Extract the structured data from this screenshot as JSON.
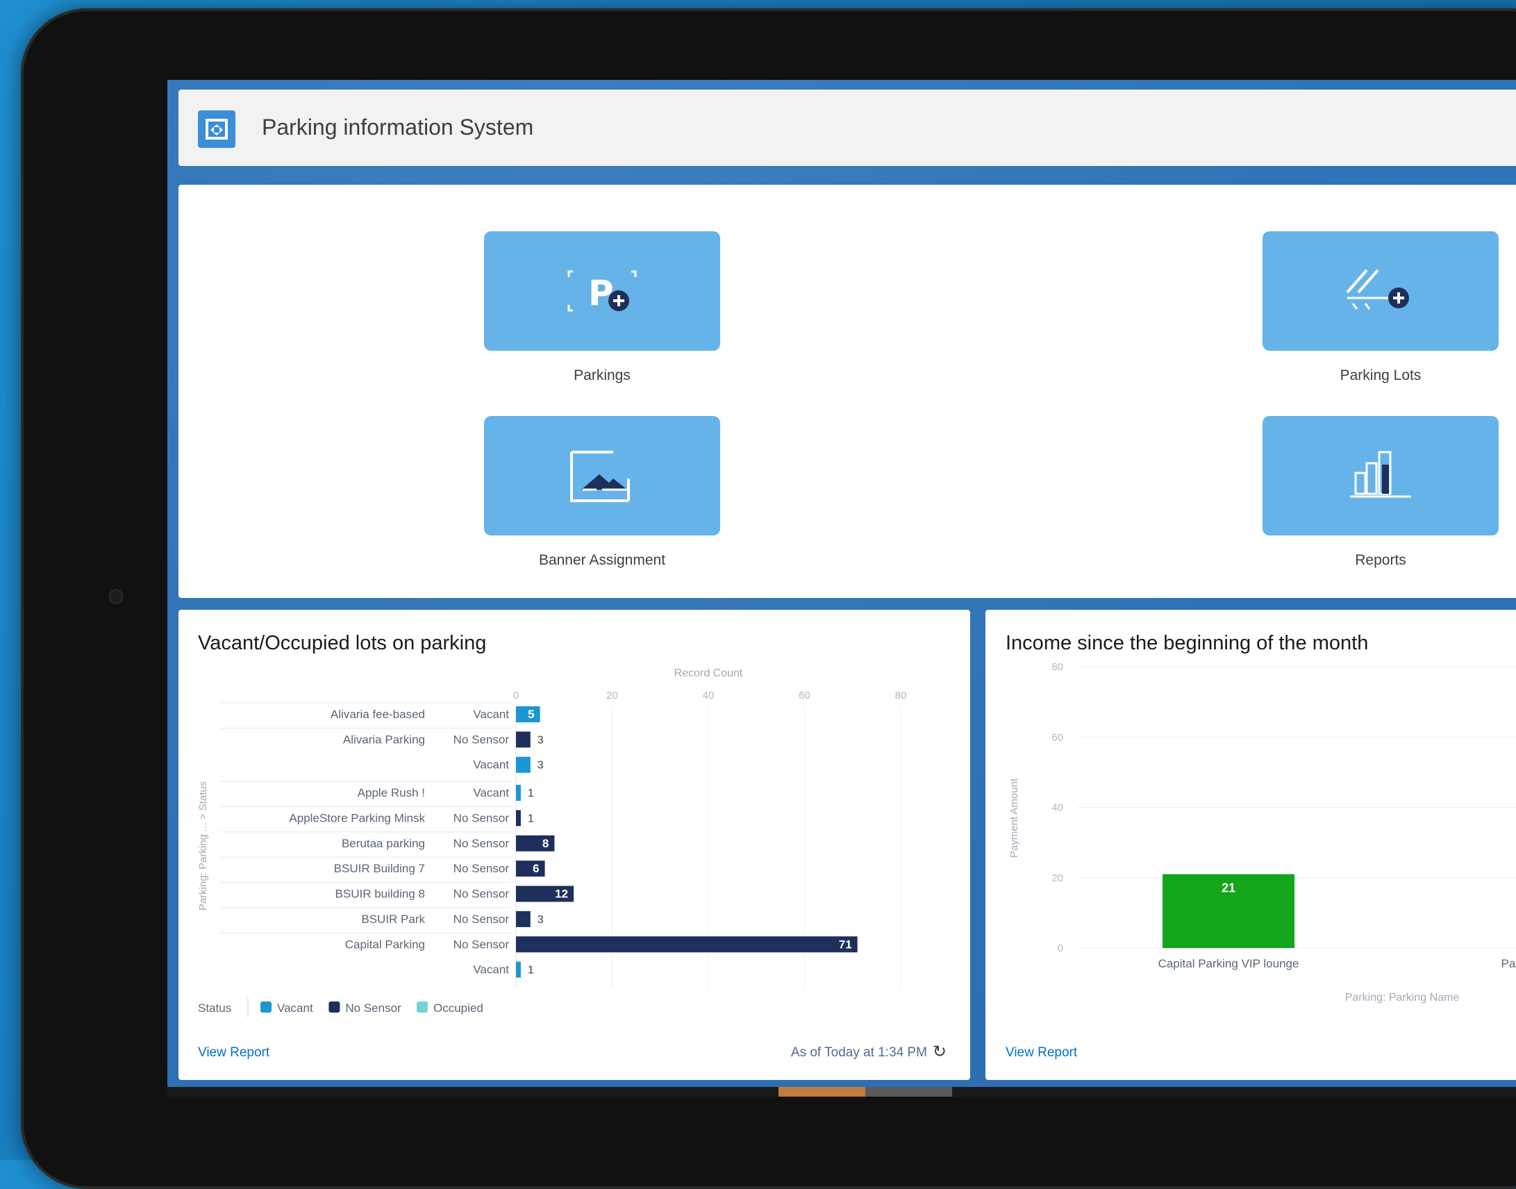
{
  "app": {
    "title": "Parking information System"
  },
  "tiles": [
    {
      "label": "Parkings",
      "icon": "parking-add-icon"
    },
    {
      "label": "Parking Lots",
      "icon": "parking-lots-add-icon"
    },
    {
      "label": "Banner Assignment",
      "icon": "banner-image-icon"
    },
    {
      "label": "Reports",
      "icon": "reports-chart-icon"
    }
  ],
  "cards": {
    "vacant": {
      "title": "Vacant/Occupied lots on parking",
      "view_report": "View Report",
      "as_of": "As of Today at 1:34 PM"
    },
    "income": {
      "title": "Income since the beginning of the month",
      "view_report": "View Report"
    }
  },
  "colors": {
    "vacant": "#1b96d3",
    "no_sensor": "#1f2f5c",
    "occupied": "#74d4d2",
    "income_bar": "#13a51b",
    "tile": "#66b3ea",
    "link": "#0070d2"
  },
  "chart_data": [
    {
      "type": "bar",
      "orientation": "horizontal",
      "xlabel": "Record Count",
      "ylabel": "Parking: Parking ... > Status",
      "xlim": [
        0,
        80
      ],
      "xticks": [
        "0",
        "20",
        "40",
        "60",
        "80"
      ],
      "grid": true,
      "legend": {
        "title": "Status",
        "placement": "bottom",
        "entries": [
          "Vacant",
          "No Sensor",
          "Occupied"
        ]
      },
      "rows": [
        {
          "parking": "Alivaria fee-based",
          "status": "Vacant",
          "value": 5,
          "label": "5"
        },
        {
          "parking": "Alivaria Parking",
          "status": "No Sensor",
          "value": 3,
          "label": "3"
        },
        {
          "parking": "",
          "status": "Vacant",
          "value": 3,
          "label": "3"
        },
        {
          "parking": "Apple Rush !",
          "status": "Vacant",
          "value": 1,
          "label": "1"
        },
        {
          "parking": "AppleStore Parking Minsk",
          "status": "No Sensor",
          "value": 1,
          "label": "1"
        },
        {
          "parking": "Berutaa parking",
          "status": "No Sensor",
          "value": 8,
          "label": "8"
        },
        {
          "parking": "BSUIR Building 7",
          "status": "No Sensor",
          "value": 6,
          "label": "6"
        },
        {
          "parking": "BSUIR building 8",
          "status": "No Sensor",
          "value": 12,
          "label": "12"
        },
        {
          "parking": "BSUIR Park",
          "status": "No Sensor",
          "value": 3,
          "label": "3"
        },
        {
          "parking": "Capital Parking",
          "status": "No Sensor",
          "value": 71,
          "label": "71"
        },
        {
          "parking": "",
          "status": "Vacant",
          "value": 1,
          "label": "1"
        }
      ]
    },
    {
      "type": "bar",
      "orientation": "vertical",
      "xlabel": "Parking: Parking Name",
      "ylabel": "Payment Amount",
      "ylim": [
        0,
        80
      ],
      "yticks": [
        "0",
        "20",
        "40",
        "60",
        "80"
      ],
      "grid": true,
      "categories": [
        "Capital Parking VIP lounge",
        "Park"
      ],
      "values": [
        21,
        null
      ],
      "labels": [
        "21",
        ""
      ]
    }
  ]
}
